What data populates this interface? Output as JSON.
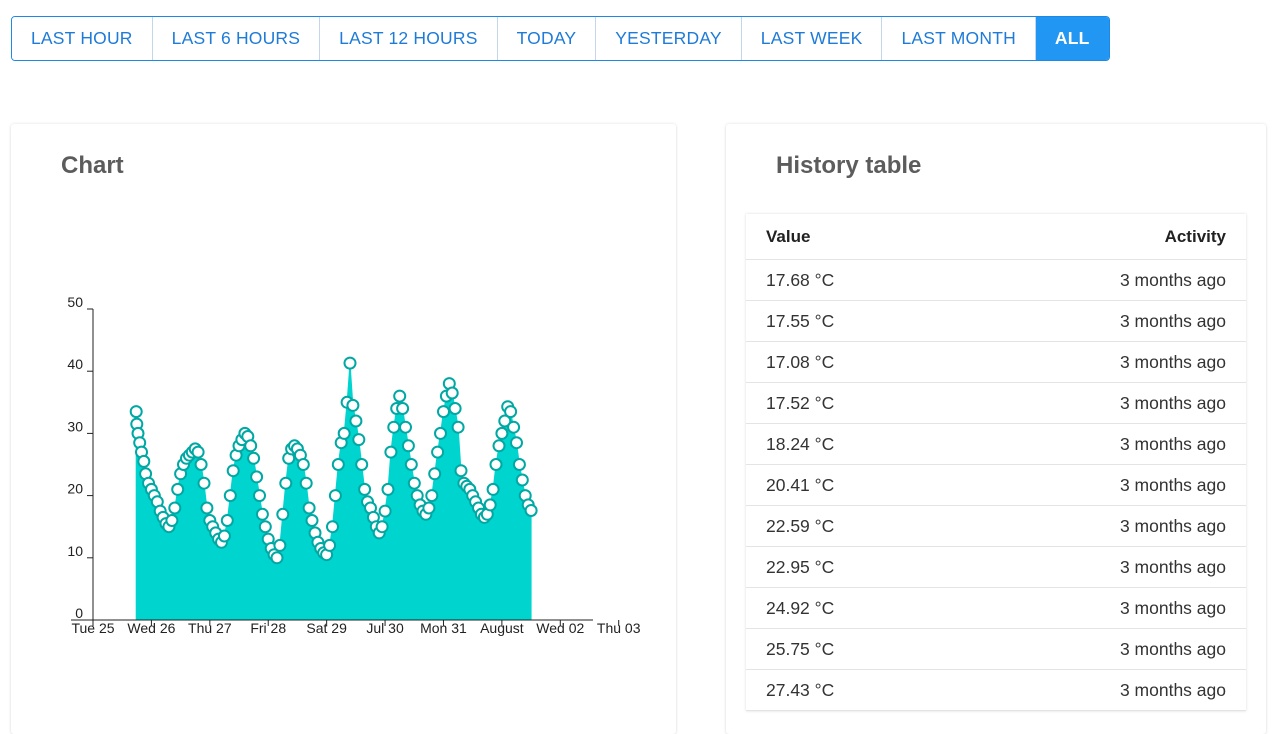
{
  "range": {
    "buttons": [
      {
        "label": "LAST HOUR",
        "active": false
      },
      {
        "label": "LAST 6 HOURS",
        "active": false
      },
      {
        "label": "LAST 12 HOURS",
        "active": false
      },
      {
        "label": "TODAY",
        "active": false
      },
      {
        "label": "YESTERDAY",
        "active": false
      },
      {
        "label": "LAST WEEK",
        "active": false
      },
      {
        "label": "LAST MONTH",
        "active": false
      },
      {
        "label": "ALL",
        "active": true
      }
    ]
  },
  "chart_card": {
    "title": "Chart"
  },
  "table_card": {
    "title": "History table",
    "columns": [
      "Value",
      "Activity"
    ],
    "rows": [
      {
        "value": "17.68 °C",
        "activity": "3 months ago"
      },
      {
        "value": "17.55 °C",
        "activity": "3 months ago"
      },
      {
        "value": "17.08 °C",
        "activity": "3 months ago"
      },
      {
        "value": "17.52 °C",
        "activity": "3 months ago"
      },
      {
        "value": "18.24 °C",
        "activity": "3 months ago"
      },
      {
        "value": "20.41 °C",
        "activity": "3 months ago"
      },
      {
        "value": "22.59 °C",
        "activity": "3 months ago"
      },
      {
        "value": "22.95 °C",
        "activity": "3 months ago"
      },
      {
        "value": "24.92 °C",
        "activity": "3 months ago"
      },
      {
        "value": "25.75 °C",
        "activity": "3 months ago"
      },
      {
        "value": "27.43 °C",
        "activity": "3 months ago"
      }
    ]
  },
  "colors": {
    "accent": "#2196f3",
    "button_text": "#1e7bd8",
    "area_fill": "#00d4cf",
    "point_stroke": "#00a8a3",
    "point_fill": "#ffffff"
  },
  "chart_data": {
    "type": "area",
    "title": "",
    "xlabel": "",
    "ylabel": "",
    "ylim": [
      0,
      50
    ],
    "y_ticks": [
      0,
      10,
      20,
      30,
      40,
      50
    ],
    "x_ticks": [
      "Tue 25",
      "Wed 26",
      "Thu 27",
      "Fri 28",
      "Sat 29",
      "Jul 30",
      "Mon 31",
      "August",
      "Wed 02",
      "Thu 03"
    ],
    "xlim": [
      0,
      8.56
    ],
    "series": [
      {
        "markers": true,
        "points": [
          [
            0.74,
            33.5
          ],
          [
            0.75,
            31.5
          ],
          [
            0.77,
            30.0
          ],
          [
            0.8,
            28.5
          ],
          [
            0.83,
            27.0
          ],
          [
            0.87,
            25.5
          ],
          [
            0.9,
            23.5
          ],
          [
            0.95,
            22.0
          ],
          [
            1.0,
            21.0
          ],
          [
            1.05,
            20.0
          ],
          [
            1.1,
            19.0
          ],
          [
            1.15,
            17.5
          ],
          [
            1.2,
            16.5
          ],
          [
            1.25,
            15.5
          ],
          [
            1.3,
            15.0
          ],
          [
            1.35,
            16.0
          ],
          [
            1.4,
            18.0
          ],
          [
            1.45,
            21.0
          ],
          [
            1.5,
            23.5
          ],
          [
            1.55,
            25.0
          ],
          [
            1.6,
            26.0
          ],
          [
            1.65,
            26.5
          ],
          [
            1.7,
            27.0
          ],
          [
            1.75,
            27.5
          ],
          [
            1.8,
            27.0
          ],
          [
            1.85,
            25.0
          ],
          [
            1.9,
            22.0
          ],
          [
            1.95,
            18.0
          ],
          [
            2.0,
            16.0
          ],
          [
            2.05,
            15.0
          ],
          [
            2.1,
            14.0
          ],
          [
            2.15,
            13.0
          ],
          [
            2.2,
            12.5
          ],
          [
            2.25,
            13.5
          ],
          [
            2.3,
            16.0
          ],
          [
            2.35,
            20.0
          ],
          [
            2.4,
            24.0
          ],
          [
            2.45,
            26.5
          ],
          [
            2.5,
            28.0
          ],
          [
            2.55,
            29.0
          ],
          [
            2.6,
            30.0
          ],
          [
            2.65,
            29.5
          ],
          [
            2.7,
            28.0
          ],
          [
            2.75,
            26.0
          ],
          [
            2.8,
            23.0
          ],
          [
            2.85,
            20.0
          ],
          [
            2.9,
            17.0
          ],
          [
            2.95,
            15.0
          ],
          [
            3.0,
            13.0
          ],
          [
            3.05,
            11.5
          ],
          [
            3.1,
            10.5
          ],
          [
            3.15,
            10.0
          ],
          [
            3.2,
            12.0
          ],
          [
            3.25,
            17.0
          ],
          [
            3.3,
            22.0
          ],
          [
            3.35,
            26.0
          ],
          [
            3.4,
            27.5
          ],
          [
            3.45,
            28.0
          ],
          [
            3.5,
            27.5
          ],
          [
            3.55,
            26.5
          ],
          [
            3.6,
            25.0
          ],
          [
            3.65,
            22.0
          ],
          [
            3.7,
            18.0
          ],
          [
            3.75,
            16.0
          ],
          [
            3.8,
            14.0
          ],
          [
            3.85,
            12.5
          ],
          [
            3.9,
            11.5
          ],
          [
            3.95,
            10.8
          ],
          [
            4.0,
            10.5
          ],
          [
            4.05,
            12.0
          ],
          [
            4.1,
            15.0
          ],
          [
            4.15,
            20.0
          ],
          [
            4.2,
            25.0
          ],
          [
            4.25,
            28.5
          ],
          [
            4.3,
            30.0
          ],
          [
            4.35,
            35.0
          ],
          [
            4.4,
            41.3
          ],
          [
            4.45,
            34.5
          ],
          [
            4.5,
            32.0
          ],
          [
            4.55,
            29.0
          ],
          [
            4.6,
            25.0
          ],
          [
            4.65,
            21.0
          ],
          [
            4.7,
            19.0
          ],
          [
            4.75,
            18.0
          ],
          [
            4.8,
            16.5
          ],
          [
            4.85,
            15.0
          ],
          [
            4.9,
            14.0
          ],
          [
            4.95,
            15.0
          ],
          [
            5.0,
            17.5
          ],
          [
            5.05,
            21.0
          ],
          [
            5.1,
            27.0
          ],
          [
            5.15,
            31.0
          ],
          [
            5.2,
            34.0
          ],
          [
            5.25,
            36.0
          ],
          [
            5.3,
            34.0
          ],
          [
            5.35,
            31.0
          ],
          [
            5.4,
            28.0
          ],
          [
            5.45,
            25.0
          ],
          [
            5.5,
            22.0
          ],
          [
            5.55,
            20.0
          ],
          [
            5.6,
            18.5
          ],
          [
            5.65,
            17.5
          ],
          [
            5.7,
            17.0
          ],
          [
            5.75,
            18.0
          ],
          [
            5.8,
            20.0
          ],
          [
            5.85,
            23.5
          ],
          [
            5.9,
            27.0
          ],
          [
            5.95,
            30.0
          ],
          [
            6.0,
            33.5
          ],
          [
            6.05,
            36.0
          ],
          [
            6.1,
            38.0
          ],
          [
            6.15,
            36.5
          ],
          [
            6.2,
            34.0
          ],
          [
            6.25,
            31.0
          ],
          [
            6.3,
            24.0
          ],
          [
            6.35,
            22.0
          ],
          [
            6.4,
            21.5
          ],
          [
            6.45,
            21.0
          ],
          [
            6.5,
            20.0
          ],
          [
            6.55,
            19.0
          ],
          [
            6.6,
            18.0
          ],
          [
            6.65,
            17.0
          ],
          [
            6.7,
            16.5
          ],
          [
            6.75,
            17.0
          ],
          [
            6.8,
            18.5
          ],
          [
            6.85,
            21.0
          ],
          [
            6.9,
            25.0
          ],
          [
            6.95,
            28.0
          ],
          [
            7.0,
            30.0
          ],
          [
            7.05,
            32.0
          ],
          [
            7.1,
            34.3
          ],
          [
            7.15,
            33.5
          ],
          [
            7.2,
            31.0
          ],
          [
            7.25,
            28.5
          ],
          [
            7.3,
            25.0
          ],
          [
            7.35,
            22.5
          ],
          [
            7.4,
            20.0
          ],
          [
            7.45,
            18.5
          ],
          [
            7.5,
            17.6
          ]
        ]
      }
    ]
  }
}
